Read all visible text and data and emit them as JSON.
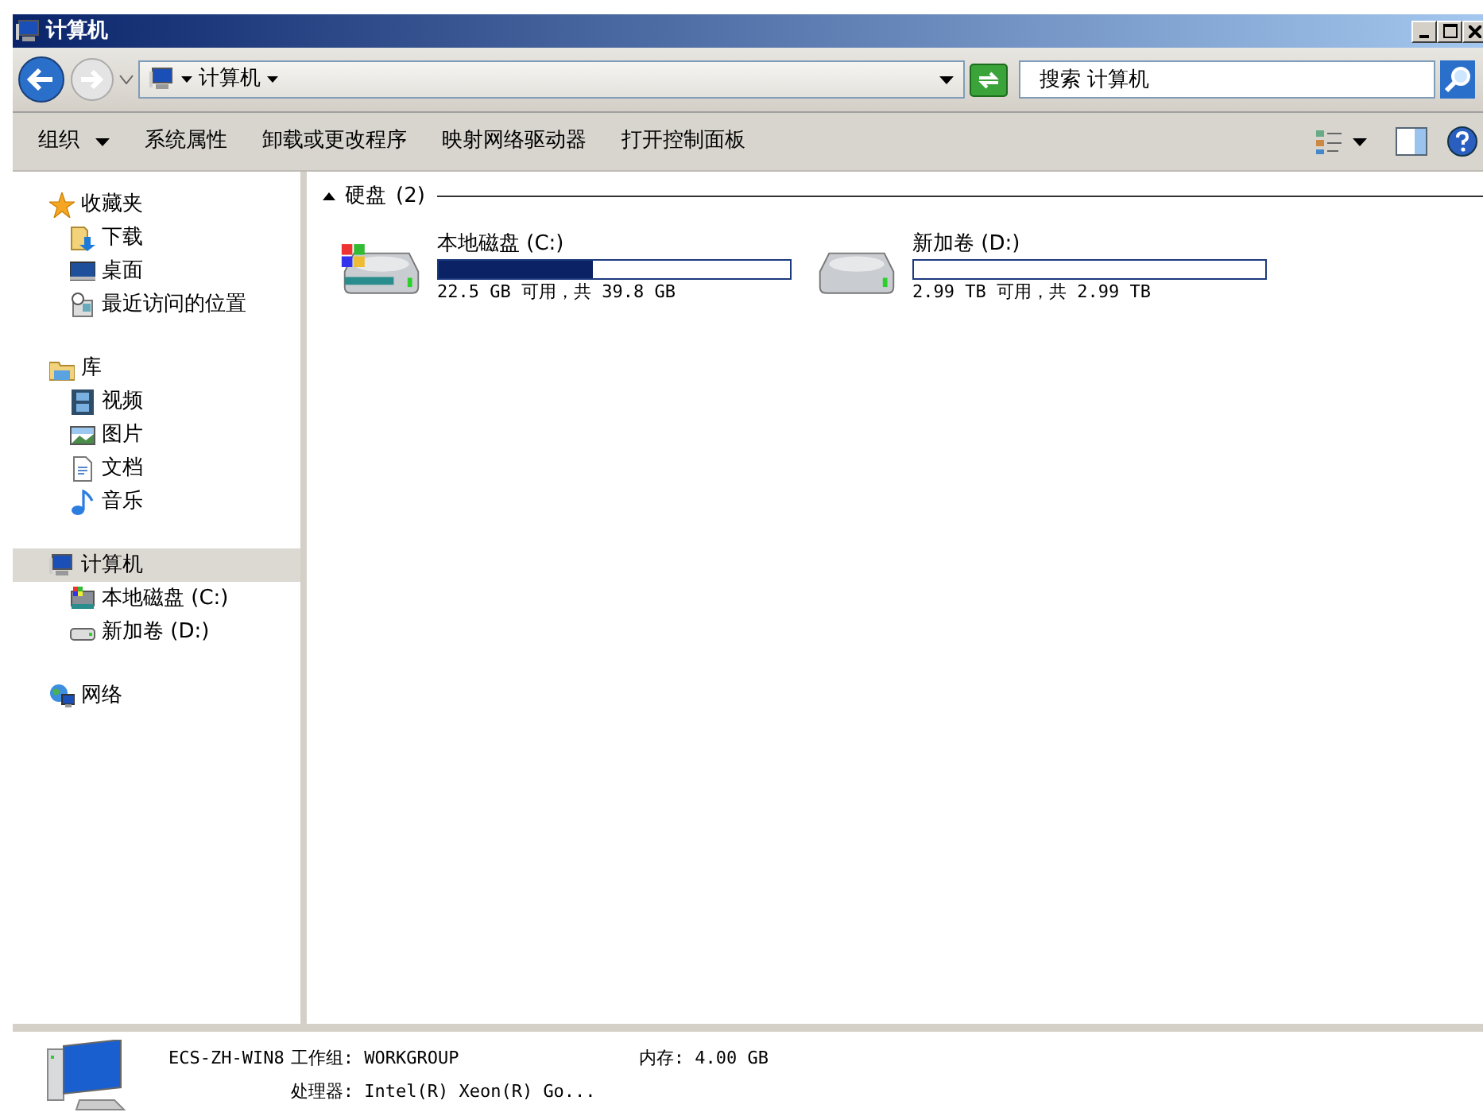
{
  "window": {
    "title": "计算机"
  },
  "address": {
    "path": "计算机"
  },
  "search": {
    "placeholder": "搜索 计算机"
  },
  "toolbar": [
    {
      "label": "组织",
      "dropdown": true
    },
    {
      "label": "系统属性",
      "dropdown": false
    },
    {
      "label": "卸载或更改程序",
      "dropdown": false
    },
    {
      "label": "映射网络驱动器",
      "dropdown": false
    },
    {
      "label": "打开控制面板",
      "dropdown": false
    }
  ],
  "sidebar": [
    {
      "label": "收藏夹",
      "selected": false,
      "children": [
        {
          "label": "下载",
          "selected": false
        },
        {
          "label": "桌面",
          "selected": false
        },
        {
          "label": "最近访问的位置",
          "selected": false
        }
      ]
    },
    {
      "label": "库",
      "selected": false,
      "children": [
        {
          "label": "视频",
          "selected": false
        },
        {
          "label": "图片",
          "selected": false
        },
        {
          "label": "文档",
          "selected": false
        },
        {
          "label": "音乐",
          "selected": false
        }
      ]
    },
    {
      "label": "计算机",
      "selected": true,
      "children": [
        {
          "label": "本地磁盘 (C:)",
          "selected": false
        },
        {
          "label": "新加卷 (D:)",
          "selected": false
        }
      ]
    },
    {
      "label": "网络",
      "selected": false
    }
  ],
  "section": {
    "title": "硬盘",
    "count": "(2)",
    "expanded": true
  },
  "drives": [
    {
      "name": "本地磁盘 (C:)",
      "level": 0.44,
      "free": "22.5 GB 可用，共 39.8 GB",
      "system": true
    },
    {
      "name": "新加卷 (D:)",
      "level": 0,
      "free": "2.99 TB 可用，共 2.99 TB",
      "system": false
    }
  ],
  "details": {
    "computer_name": "ECS-ZH-WIN8",
    "workgroup": "工作组: WORKGROUP",
    "memory": "内存: 4.00 GB",
    "processor": "处理器: Intel(R) Xeon(R) Go..."
  }
}
